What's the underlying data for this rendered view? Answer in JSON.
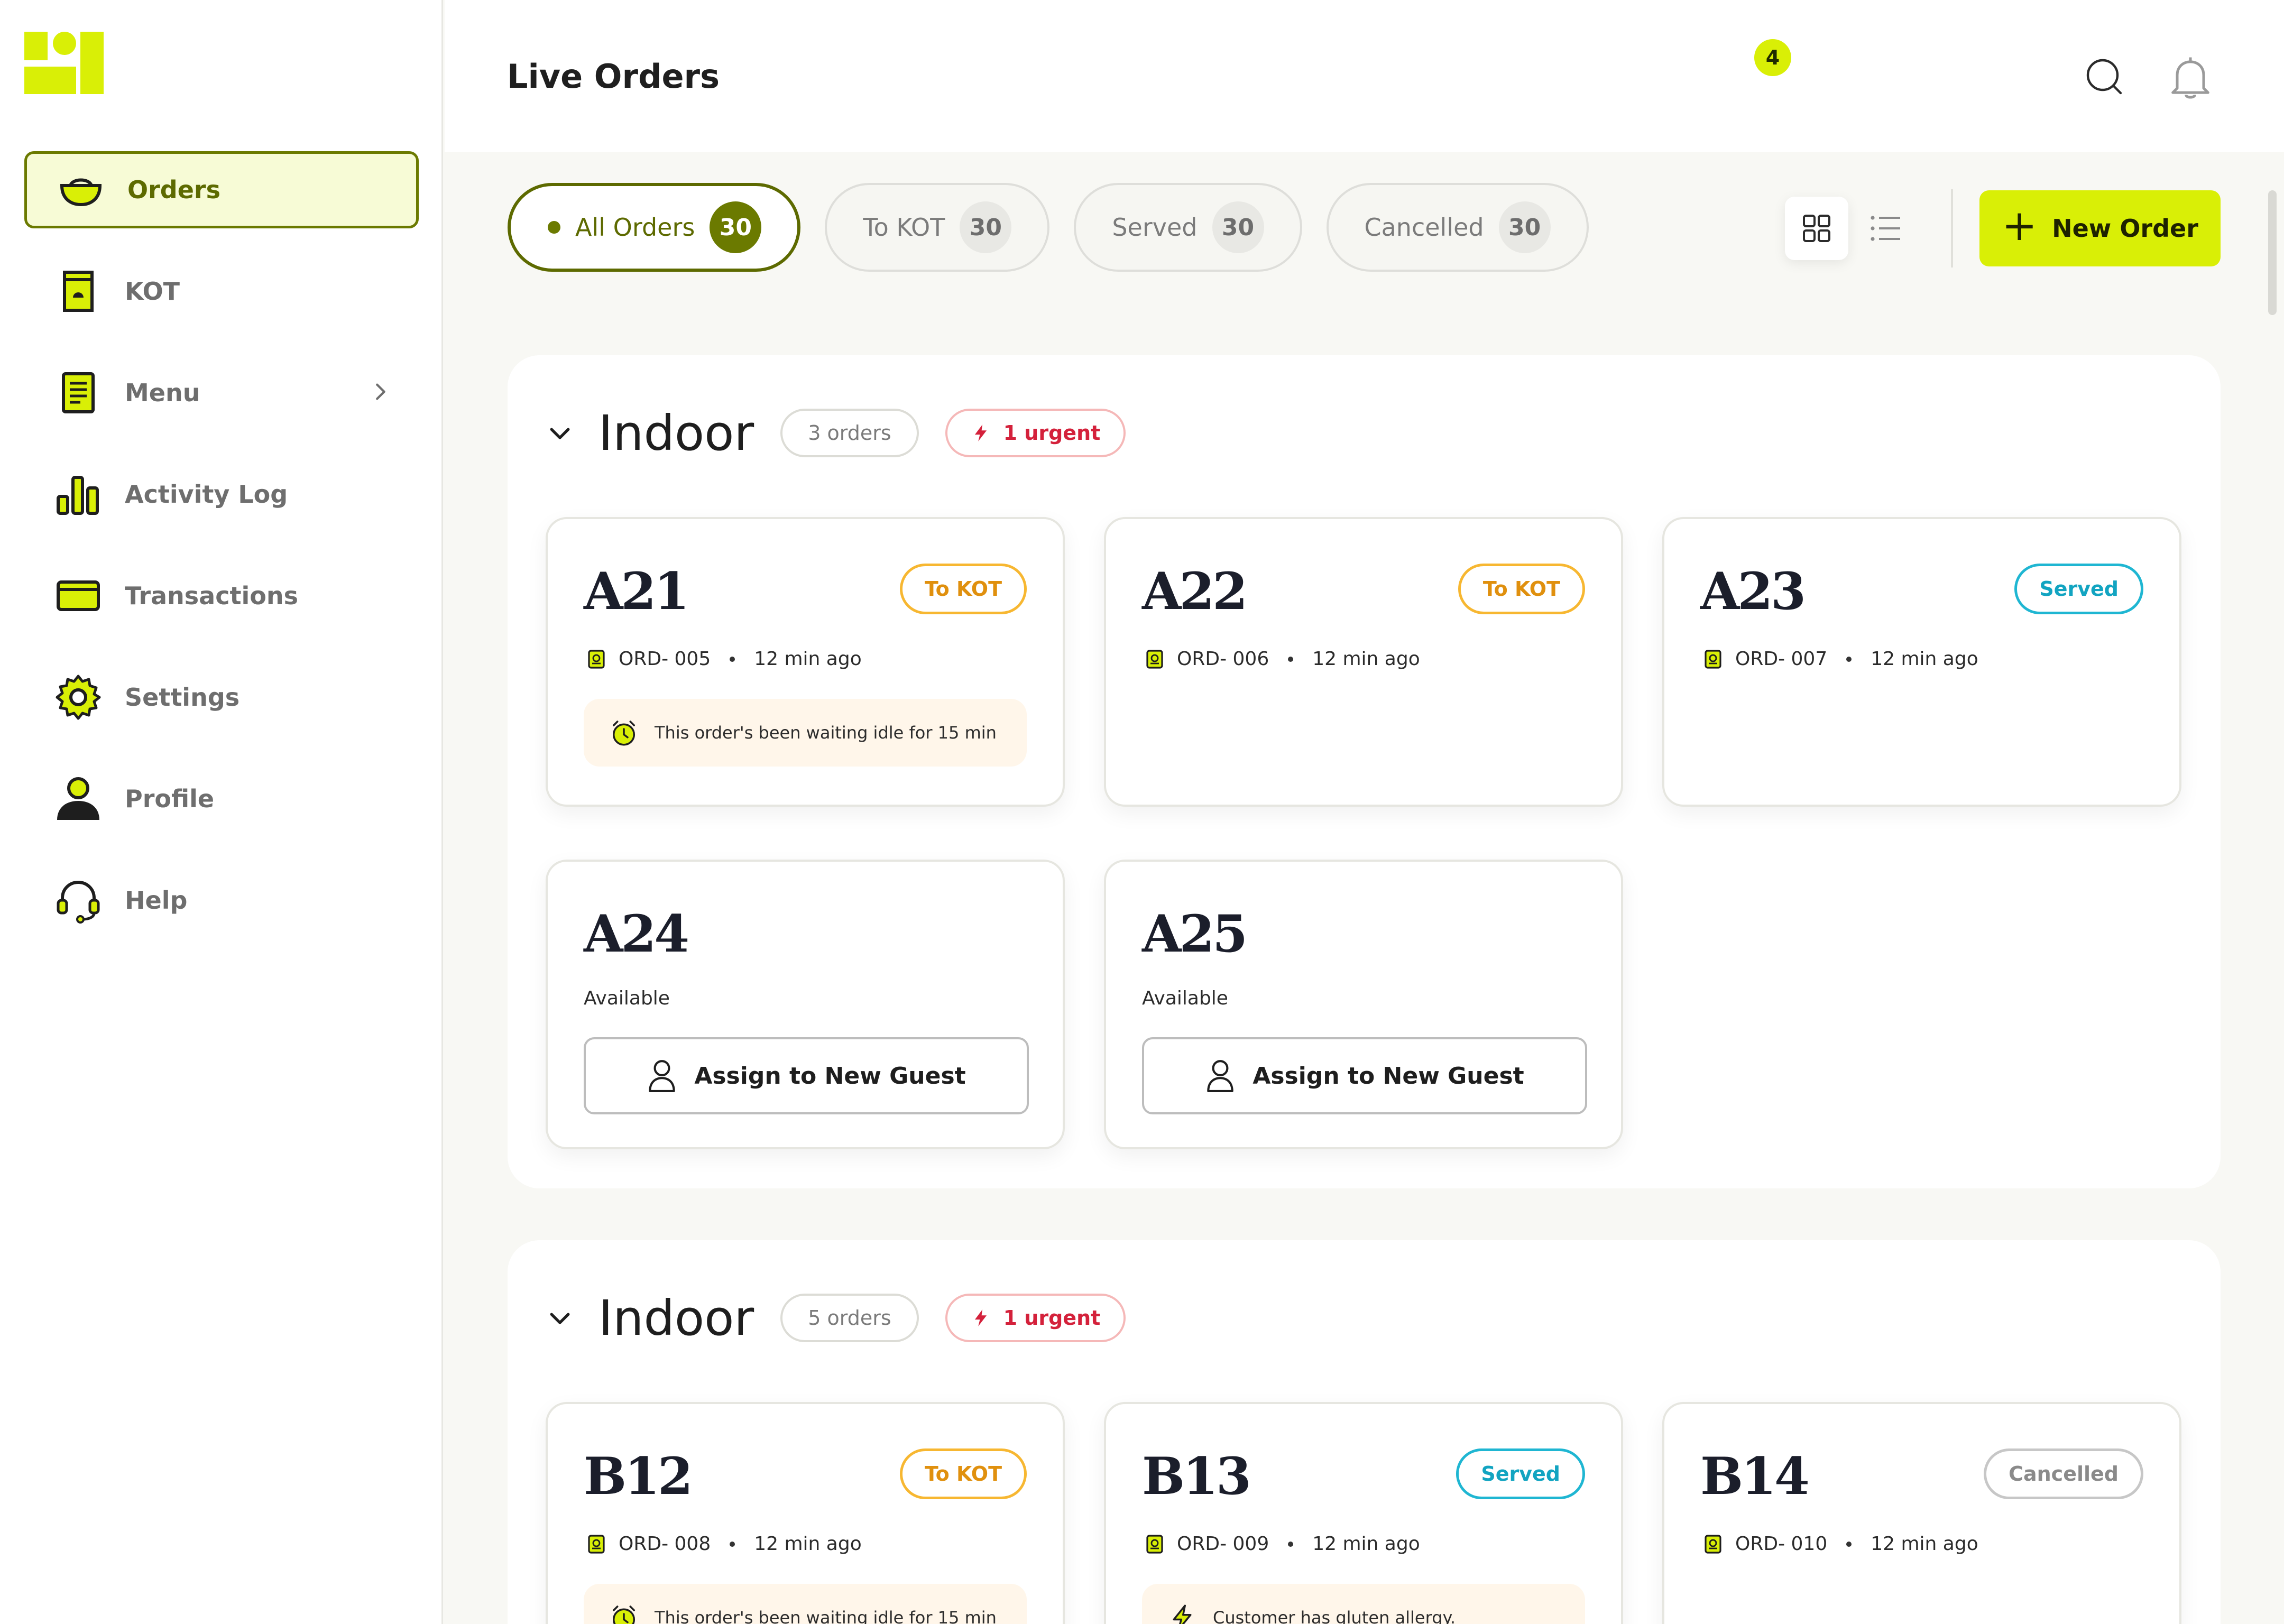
{
  "app": {
    "page_title": "Live Orders",
    "notification_count": "4",
    "brand_color": "#d9ef06",
    "accent_color": "#6b7a00"
  },
  "sidebar": {
    "items": [
      {
        "label": "Orders",
        "icon": "bowl-icon",
        "active": true
      },
      {
        "label": "KOT",
        "icon": "kot-icon"
      },
      {
        "label": "Menu",
        "icon": "menu-list-icon",
        "has_chevron": true
      },
      {
        "label": "Activity Log",
        "icon": "bar-chart-icon"
      },
      {
        "label": "Transactions",
        "icon": "card-icon"
      },
      {
        "label": "Settings",
        "icon": "gear-icon"
      },
      {
        "label": "Profile",
        "icon": "person-icon"
      },
      {
        "label": "Help",
        "icon": "headset-icon"
      }
    ]
  },
  "filters": [
    {
      "label": "All Orders",
      "count": "30",
      "active": true
    },
    {
      "label": "To KOT",
      "count": "30"
    },
    {
      "label": "Served",
      "count": "30"
    },
    {
      "label": "Cancelled",
      "count": "30"
    }
  ],
  "toolbar": {
    "new_order_label": "New Order",
    "new_order_icon": "plus-icon"
  },
  "sections": [
    {
      "title": "Indoor",
      "orders_label": "3 orders",
      "urgent_label": "1 urgent",
      "cards": [
        {
          "table": "A21",
          "status": "To KOT",
          "status_type": "kot",
          "order_id": "ORD- 005",
          "time": "12 min ago",
          "note": "This order's been waiting idle for 15 min",
          "note_icon": "alarm-clock-icon"
        },
        {
          "table": "A22",
          "status": "To KOT",
          "status_type": "kot",
          "order_id": "ORD- 006",
          "time": "12 min ago"
        },
        {
          "table": "A23",
          "status": "Served",
          "status_type": "served",
          "order_id": "ORD- 007",
          "time": "12 min ago"
        },
        {
          "table": "A24",
          "available_label": "Available",
          "assign_label": "Assign to New Guest"
        },
        {
          "table": "A25",
          "available_label": "Available",
          "assign_label": "Assign to New Guest"
        }
      ]
    },
    {
      "title": "Indoor",
      "orders_label": "5 orders",
      "urgent_label": "1 urgent",
      "cards": [
        {
          "table": "B12",
          "status": "To KOT",
          "status_type": "kot",
          "order_id": "ORD- 008",
          "time": "12 min ago",
          "note": "This order's been waiting idle for 15 min",
          "note_icon": "alarm-clock-icon"
        },
        {
          "table": "B13",
          "status": "Served",
          "status_type": "served",
          "order_id": "ORD- 009",
          "time": "12 min ago",
          "note": "Customer has gluten allergy.",
          "note_icon": "lightning-icon"
        },
        {
          "table": "B14",
          "status": "Cancelled",
          "status_type": "cancelled",
          "order_id": "ORD- 010",
          "time": "12 min ago"
        }
      ]
    }
  ]
}
